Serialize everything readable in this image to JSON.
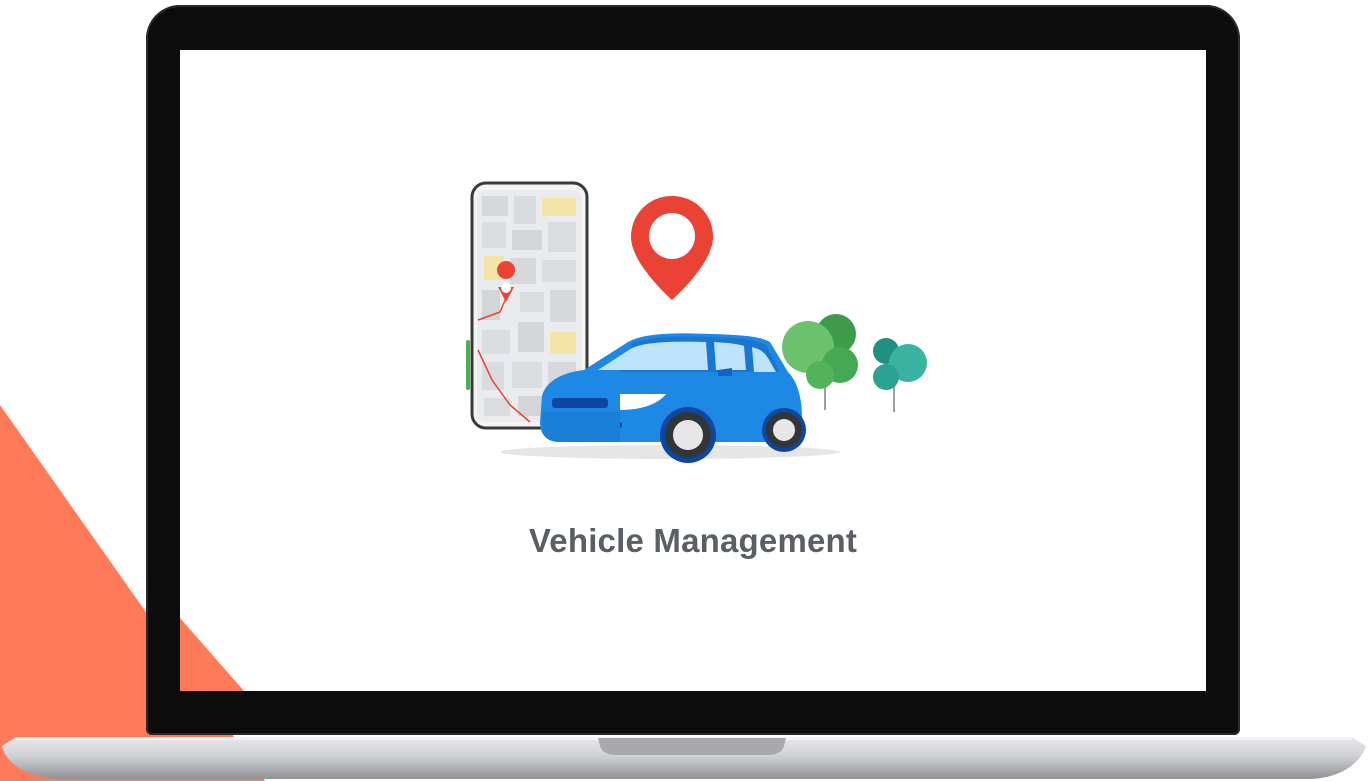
{
  "screen": {
    "caption": "Vehicle Management"
  },
  "colors": {
    "accent": "#ff7a59",
    "car_body": "#1e88e5",
    "pin": "#ea4335",
    "tree_light": "#5cb85c",
    "tree_teal": "#2aa394",
    "caption_text": "#5a5f66",
    "bezel": "#0c0c0c",
    "chassis": "#c9cacc"
  },
  "icons": {
    "phone": "phone-map-icon",
    "pin": "location-pin-icon",
    "car": "car-icon",
    "trees": "tree-icon"
  }
}
